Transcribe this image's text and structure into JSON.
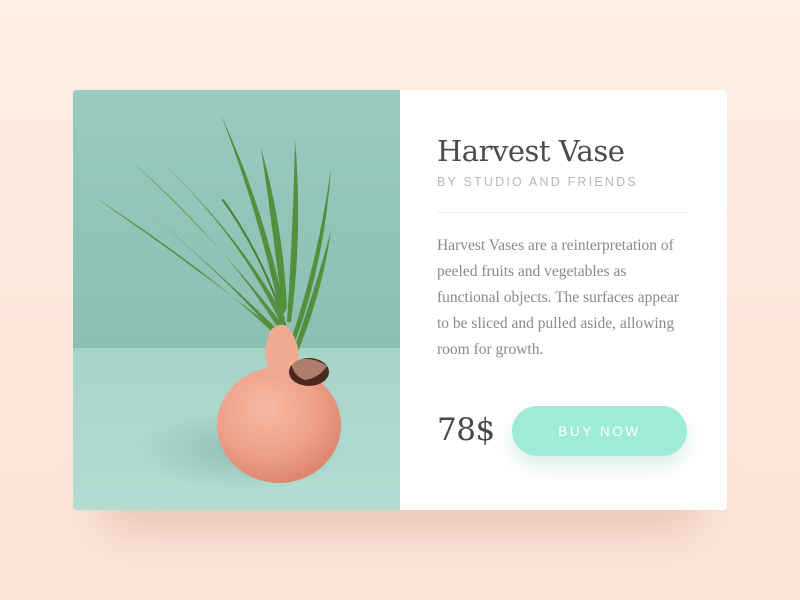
{
  "product": {
    "title": "Harvest Vase",
    "subtitle": "BY STUDIO AND FRIENDS",
    "description": "Harvest Vases are a reinterpretation of peeled fruits and vegetables as functional objects. The surfaces appear to be sliced and pulled aside, allowing room for growth.",
    "price": "78$",
    "buy_label": "BUY NOW"
  },
  "colors": {
    "background": "#fde9df",
    "card": "#ffffff",
    "photo_wall": "#8fc3b6",
    "photo_table": "#a9d6cb",
    "vase": "#f0a58f",
    "leaf": "#4f8a3a",
    "button": "#9eecd8",
    "title_text": "#4d4a4a",
    "muted_text": "#b9b6b6",
    "body_text": "#8c8888"
  },
  "icons": {
    "photo": "plant-in-vase-photo"
  }
}
